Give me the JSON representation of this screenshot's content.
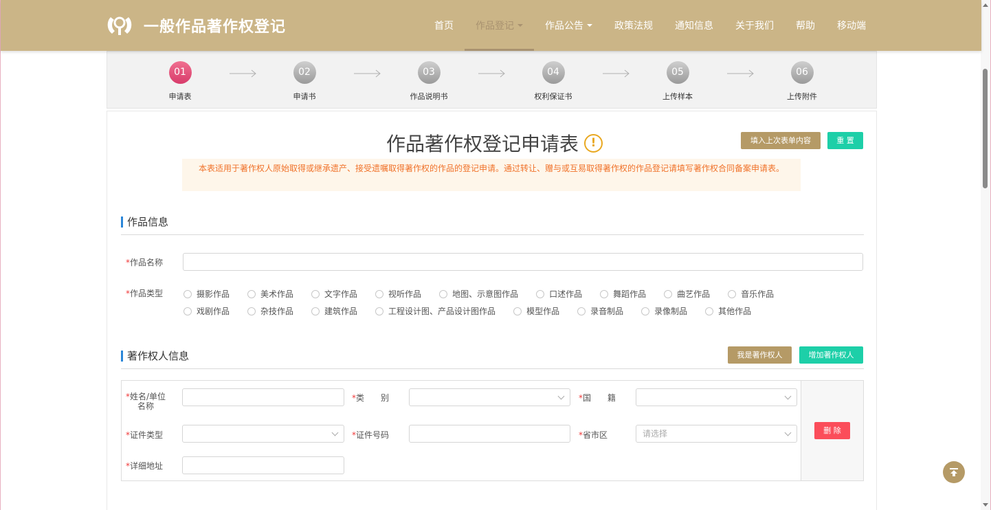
{
  "header": {
    "site_title": "一般作品著作权登记",
    "nav": [
      {
        "label": "首页",
        "dropdown": false,
        "active": false
      },
      {
        "label": "作品登记",
        "dropdown": true,
        "active": true
      },
      {
        "label": "作品公告",
        "dropdown": true,
        "active": false
      },
      {
        "label": "政策法规",
        "dropdown": false,
        "active": false
      },
      {
        "label": "通知信息",
        "dropdown": false,
        "active": false
      },
      {
        "label": "关于我们",
        "dropdown": false,
        "active": false
      },
      {
        "label": "帮助",
        "dropdown": false,
        "active": false
      },
      {
        "label": "移动端",
        "dropdown": false,
        "active": false
      }
    ]
  },
  "steps": [
    {
      "num": "01",
      "label": "申请表",
      "active": true
    },
    {
      "num": "02",
      "label": "申请书",
      "active": false
    },
    {
      "num": "03",
      "label": "作品说明书",
      "active": false
    },
    {
      "num": "04",
      "label": "权利保证书",
      "active": false
    },
    {
      "num": "05",
      "label": "上传样本",
      "active": false
    },
    {
      "num": "06",
      "label": "上传附件",
      "active": false
    }
  ],
  "form": {
    "title": "作品著作权登记申请表",
    "fill_last_label": "填入上次表单内容",
    "reset_label": "重 置",
    "notice": "本表适用于著作权人原始取得或继承遗产、接受遗嘱取得著作权的作品的登记申请。通过转让、赠与或互易取得著作权的作品登记请填写著作权合同备案申请表。"
  },
  "work_info": {
    "section_title": "作品信息",
    "name_label": "作品名称",
    "name_value": "",
    "type_label": "作品类型",
    "types_row1": [
      "摄影作品",
      "美术作品",
      "文字作品",
      "视听作品",
      "地图、示意图作品",
      "口述作品",
      "舞蹈作品",
      "曲艺作品",
      "音乐作品"
    ],
    "types_row2": [
      "戏剧作品",
      "杂技作品",
      "建筑作品",
      "工程设计图、产品设计图作品",
      "模型作品",
      "录音制品",
      "录像制品",
      "其他作品"
    ]
  },
  "owner_info": {
    "section_title": "著作权人信息",
    "i_am_owner_label": "我是著作权人",
    "add_owner_label": "增加著作权人",
    "name_label_line1": "姓名/单位",
    "name_label_line2": "名称",
    "category_label": "类　　别",
    "nationality_label": "国　　籍",
    "id_type_label": "证件类型",
    "id_number_label": "证件号码",
    "region_label": "省市区",
    "region_placeholder": "请选择",
    "address_label": "详细地址",
    "delete_label": "删 除"
  },
  "colors": {
    "header_bg": "#cbb587",
    "accent_gold": "#b59a66",
    "teal": "#1dcfa8",
    "red": "#fb4d5a",
    "active_step": "#d83c6b",
    "notice_text": "#f0722a"
  }
}
